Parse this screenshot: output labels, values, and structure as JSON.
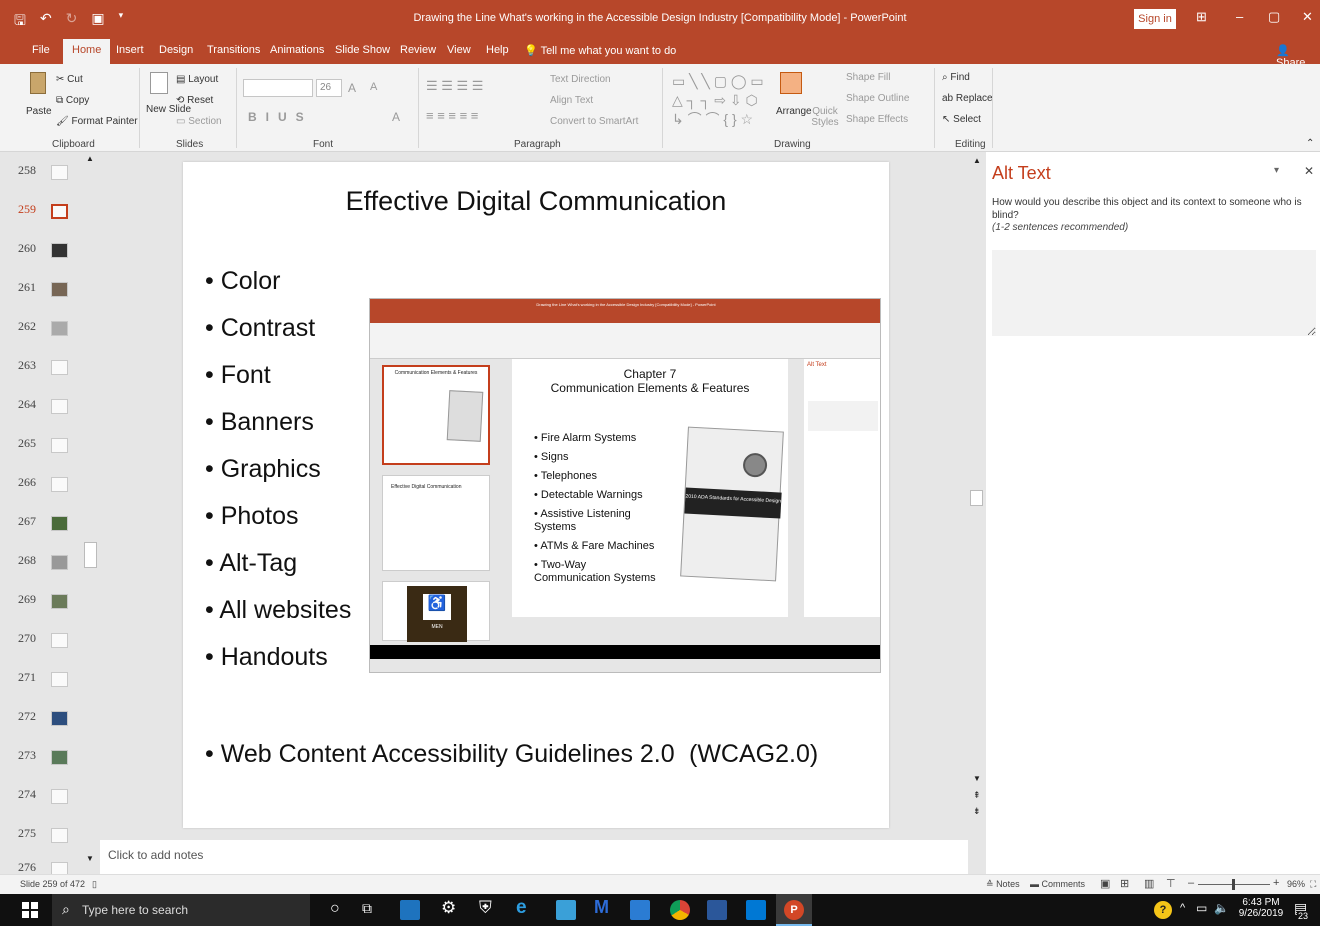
{
  "window": {
    "title": "Drawing the Line What's working in the Accessible Design Industry [Compatibility Mode] - PowerPoint",
    "signin_label": "Sign in",
    "minimize": "–",
    "restore": "▢",
    "close": "✕"
  },
  "ribbon_tabs": [
    "File",
    "Home",
    "Insert",
    "Design",
    "Transitions",
    "Animations",
    "Slide Show",
    "Review",
    "View",
    "Help"
  ],
  "tellme": "Tell me what you want to do",
  "share_label": "Share",
  "ribbon": {
    "clipboard": {
      "label": "Clipboard",
      "paste": "Paste",
      "cut": "Cut",
      "copy": "Copy",
      "format_painter": "Format Painter"
    },
    "slides": {
      "label": "Slides",
      "new_slide": "New Slide",
      "layout": "Layout",
      "reset": "Reset",
      "section": "Section"
    },
    "font": {
      "label": "Font",
      "size": "26"
    },
    "paragraph": {
      "label": "Paragraph",
      "text_direction": "Text Direction",
      "align_text": "Align Text",
      "convert_smartart": "Convert to SmartArt"
    },
    "drawing": {
      "label": "Drawing",
      "arrange": "Arrange",
      "quick_styles": "Quick Styles",
      "shape_fill": "Shape Fill",
      "shape_outline": "Shape Outline",
      "shape_effects": "Shape Effects"
    },
    "editing": {
      "label": "Editing",
      "find": "Find",
      "replace": "Replace",
      "select": "Select"
    }
  },
  "thumbnails": [
    "258",
    "259",
    "260",
    "261",
    "262",
    "263",
    "264",
    "265",
    "266",
    "267",
    "268",
    "269",
    "270",
    "271",
    "272",
    "273",
    "274",
    "275",
    "276"
  ],
  "selected_thumbnail": "259",
  "slide": {
    "title": "Effective Digital Communication",
    "bullets": [
      "Color",
      "Contrast",
      "Font",
      "Banners",
      "Graphics",
      "Photos",
      "Alt-Tag",
      "All websites",
      "Handouts"
    ],
    "wcag": "Web Content Accessibility Guidelines 2.0",
    "wcag_abbr": "(WCAG2.0)"
  },
  "embedded": {
    "slide_title_line1": "Chapter 7",
    "slide_title_line2": "Communication Elements & Features",
    "bullets": [
      "Fire Alarm Systems",
      "Signs",
      "Telephones",
      "Detectable Warnings",
      "Assistive Listening Systems",
      "ATMs & Fare Machines",
      "Two-Way Communication Systems"
    ],
    "book_band": "2010 ADA Standards for Accessible Design",
    "thumb2_title": "Effective Digital Communication",
    "sign_label": "MEN"
  },
  "notes_placeholder": "Click to add notes",
  "alt_text": {
    "title": "Alt Text",
    "description": "How would you describe this object and its context to someone who is blind?",
    "hint": "(1-2 sentences recommended)"
  },
  "status": {
    "slide_info": "Slide 259 of 472",
    "notes": "Notes",
    "comments": "Comments",
    "zoom": "96%"
  },
  "taskbar": {
    "search_placeholder": "Type here to search",
    "time": "6:43 PM",
    "date": "9/26/2019",
    "notification_count": "23"
  },
  "colors": {
    "accent": "#b7472a",
    "selected": "#c43e1c",
    "taskbar": "#101010"
  }
}
